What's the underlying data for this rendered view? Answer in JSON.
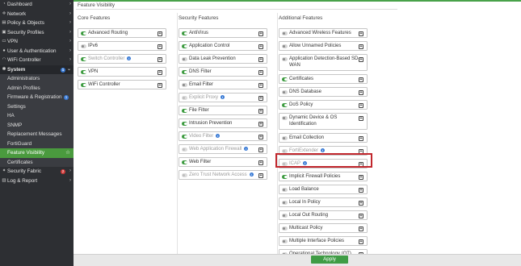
{
  "sidebar": {
    "items": [
      {
        "label": "Dashboard",
        "icon": "dashboard-icon",
        "glyph": "◔",
        "chevron": "›"
      },
      {
        "label": "Network",
        "icon": "network-icon",
        "glyph": "✛",
        "chevron": "›"
      },
      {
        "label": "Policy & Objects",
        "icon": "policy-icon",
        "glyph": "▤",
        "chevron": "›"
      },
      {
        "label": "Security Profiles",
        "icon": "lock-icon",
        "glyph": "▣",
        "chevron": "›"
      },
      {
        "label": "VPN",
        "icon": "vpn-icon",
        "glyph": "▭",
        "chevron": "›"
      },
      {
        "label": "User & Authentication",
        "icon": "user-icon",
        "glyph": "●",
        "chevron": "›"
      },
      {
        "label": "WiFi Controller",
        "icon": "wifi-icon",
        "glyph": "◠",
        "chevron": "›"
      },
      {
        "label": "System",
        "icon": "gear-icon",
        "glyph": "✱",
        "badge": "1",
        "chevron": "⌄"
      }
    ],
    "system_subitems": [
      {
        "label": "Administrators"
      },
      {
        "label": "Admin Profiles"
      },
      {
        "label": "Firmware & Registration",
        "badge": "1"
      },
      {
        "label": "Settings"
      },
      {
        "label": "HA"
      },
      {
        "label": "SNMP"
      },
      {
        "label": "Replacement Messages"
      },
      {
        "label": "FortiGuard"
      },
      {
        "label": "Feature Visibility",
        "active": true
      },
      {
        "label": "Certificates"
      }
    ],
    "bottom_items": [
      {
        "label": "Security Fabric",
        "icon": "fabric-icon",
        "glyph": "✦",
        "badge": "2",
        "chevron": "›"
      },
      {
        "label": "Log & Report",
        "icon": "log-icon",
        "glyph": "▥",
        "chevron": "›"
      }
    ],
    "colors": {
      "bg": "#2d2f33",
      "active": "#4a9a3e",
      "badge_blue": "#3a7bd5",
      "badge_red": "#d23b3b"
    }
  },
  "page": {
    "title": "Feature Visibility",
    "apply_label": "Apply"
  },
  "columns": [
    {
      "title": "Core Features",
      "features": [
        {
          "label": "Advanced Routing",
          "state": "on"
        },
        {
          "label": "IPv6",
          "state": "off"
        },
        {
          "label": "Switch Controller",
          "state": "on",
          "disabled": true,
          "info": true
        },
        {
          "label": "VPN",
          "state": "on"
        },
        {
          "label": "WiFi Controller",
          "state": "on"
        }
      ]
    },
    {
      "title": "Security Features",
      "features": [
        {
          "label": "AntiVirus",
          "state": "on"
        },
        {
          "label": "Application Control",
          "state": "on"
        },
        {
          "label": "Data Leak Prevention",
          "state": "off"
        },
        {
          "label": "DNS Filter",
          "state": "on"
        },
        {
          "label": "Email Filter",
          "state": "off"
        },
        {
          "label": "Explicit Proxy",
          "state": "dim",
          "disabled": true,
          "info": true
        },
        {
          "label": "File Filter",
          "state": "on"
        },
        {
          "label": "Intrusion Prevention",
          "state": "on"
        },
        {
          "label": "Video Filter",
          "state": "on",
          "disabled": true,
          "info": true
        },
        {
          "label": "Web Application Firewall",
          "state": "dim",
          "disabled": true,
          "info": true
        },
        {
          "label": "Web Filter",
          "state": "on"
        },
        {
          "label": "Zero Trust Network Access",
          "state": "dim",
          "disabled": true,
          "info": true
        }
      ]
    },
    {
      "title": "Additional Features",
      "features": [
        {
          "label": "Advanced Wireless Features",
          "state": "off"
        },
        {
          "label": "Allow Unnamed Policies",
          "state": "off"
        },
        {
          "label": "Application Detection-Based SD-WAN",
          "state": "off",
          "tall": true
        },
        {
          "label": "Certificates",
          "state": "on"
        },
        {
          "label": "DNS Database",
          "state": "off"
        },
        {
          "label": "DoS Policy",
          "state": "on"
        },
        {
          "label": "Dynamic Device & OS Identification",
          "state": "off",
          "tall": true
        },
        {
          "label": "Email Collection",
          "state": "off"
        },
        {
          "label": "FortiExtender",
          "state": "dim",
          "disabled": true,
          "info": true
        },
        {
          "label": "ICAP",
          "state": "dim",
          "disabled": true,
          "info": true
        },
        {
          "label": "Implicit Firewall Policies",
          "state": "on"
        },
        {
          "label": "Load Balance",
          "state": "off"
        },
        {
          "label": "Local In Policy",
          "state": "off"
        },
        {
          "label": "Local Out Routing",
          "state": "off"
        },
        {
          "label": "Multicast Policy",
          "state": "off"
        },
        {
          "label": "Multiple Interface Policies",
          "state": "off"
        },
        {
          "label": "Operational Technology (OT)",
          "state": "off"
        }
      ]
    }
  ],
  "icons": {
    "info": "i",
    "plus": "+",
    "star": "☆"
  },
  "accent": "#3d9b40",
  "highlight_color": "#c1272d"
}
